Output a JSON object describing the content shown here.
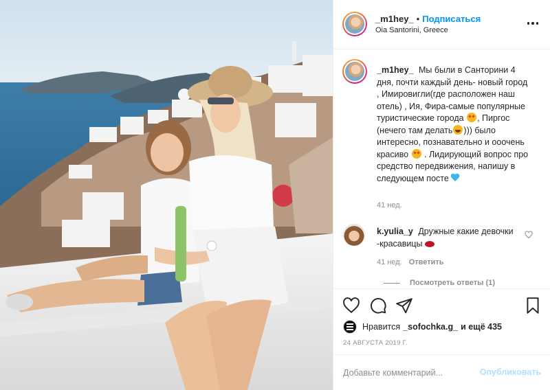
{
  "post": {
    "username": "_m1hey_",
    "separator": "•",
    "follow_label": "Подписаться",
    "location": "Oia Santorini, Greece"
  },
  "caption": {
    "username": "_m1hey_",
    "text_1": "Мы были в Санторини 4 дня, почти каждый день- новый город , Имировигли(где расположен наш отель) , Ия, Фира-самые популярные туристические города",
    "text_2": ", Пиргос (нечего там делать",
    "text_3": ")))\nбыло интересно, познавательно и ооочень красиво",
    "text_4": ". Лидирующий вопрос про средство передвижения, напишу в следующем посте",
    "time": "41 нед."
  },
  "comment": {
    "username": "k.yulia_y",
    "text": "Дружные какие девочки -красавицы",
    "time": "41 нед.",
    "reply_label": "Ответить",
    "view_replies": "Посмотреть ответы (1)"
  },
  "likes": {
    "prefix": "Нравится",
    "user": "_sofochka.g_",
    "suffix": "и ещё 435"
  },
  "date": "24 АВГУСТА 2019 Г.",
  "add_comment": {
    "placeholder": "Добавьте комментарий...",
    "publish_label": "Опубликовать"
  },
  "icons": {
    "more": "more-options-icon",
    "like": "heart-icon",
    "comment": "comment-icon",
    "share": "paper-plane-icon",
    "save": "bookmark-icon"
  },
  "colors": {
    "accent": "#0095f6",
    "publish_disabled": "#b2dffc",
    "muted": "#8e8e8e",
    "border": "#efefef"
  }
}
